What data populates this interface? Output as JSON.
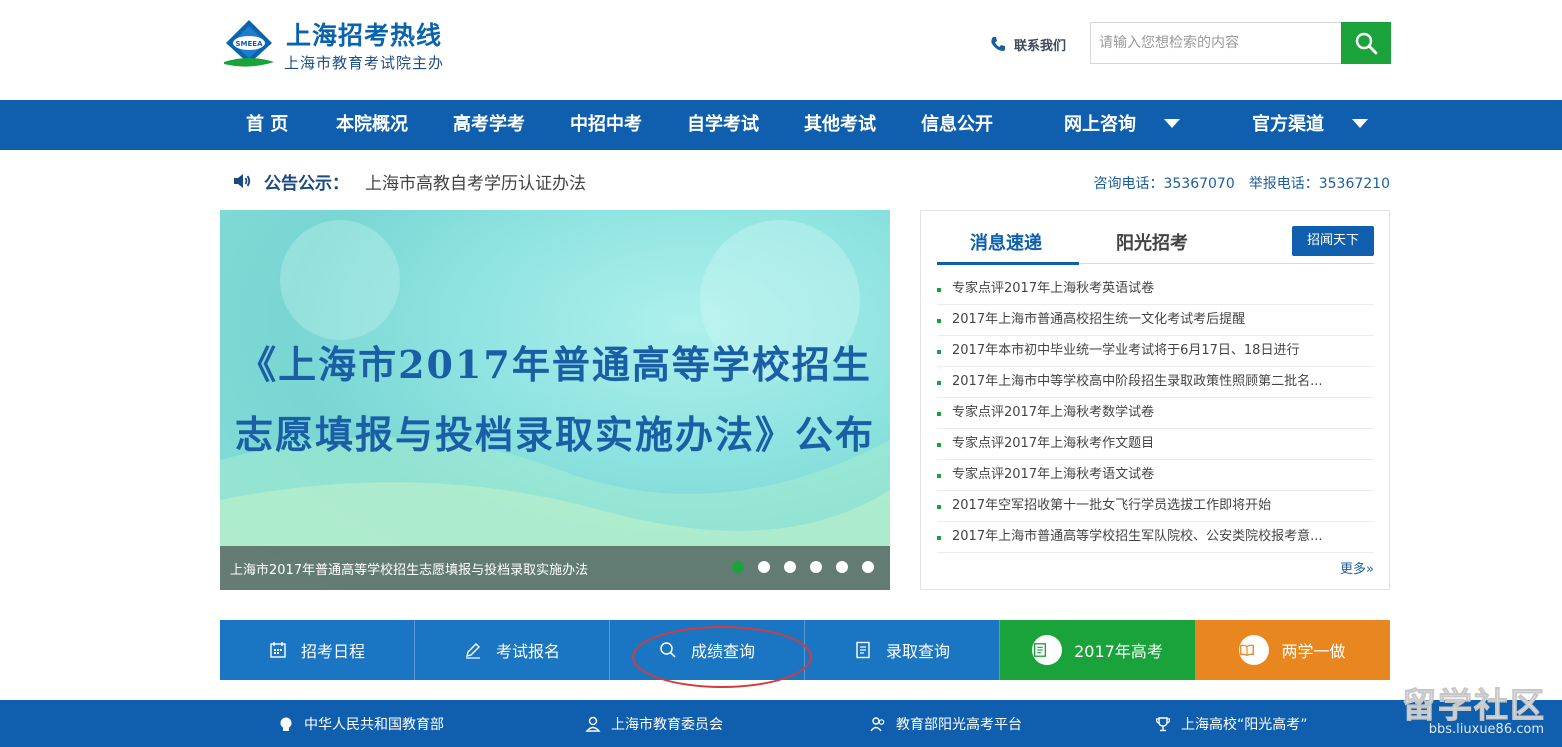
{
  "header": {
    "logo_title": "上海招考热线",
    "logo_subtitle": "上海市教育考试院主办",
    "logo_badge": "SMEEA",
    "contact_label": "联系我们",
    "search_placeholder": "请输入您想检索的内容"
  },
  "nav": {
    "items": [
      "首 页",
      "本院概况",
      "高考学考",
      "中招中考",
      "自学考试",
      "其他考试",
      "信息公开",
      "网上咨询",
      "官方渠道"
    ]
  },
  "notice": {
    "label": "公告公示：",
    "text": "上海市高教自考学历认证办法",
    "consult_phone": "咨询电话：35367070",
    "report_phone": "举报电话：35367210"
  },
  "banner": {
    "headline_line1": "《上海市2017年普通高等学校招生",
    "headline_line2": "志愿填报与投档录取实施办法》公布",
    "caption": "上海市2017年普通高等学校招生志愿填报与投档录取实施办法",
    "slide_count": 6,
    "active_slide": 1
  },
  "news": {
    "tab_active": "消息速递",
    "tab_inactive": "阳光招考",
    "tag_button": "招闻天下",
    "items": [
      "专家点评2017年上海秋考英语试卷",
      "2017年上海市普通高校招生统一文化考试考后提醒",
      "2017年本市初中毕业统一学业考试将于6月17日、18日进行",
      "2017年上海市中等学校高中阶段招生录取政策性照顾第二批名...",
      "专家点评2017年上海秋考数学试卷",
      "专家点评2017年上海秋考作文题目",
      "专家点评2017年上海秋考语文试卷",
      "2017年空军招收第十一批女飞行学员选拔工作即将开始",
      "2017年上海市普通高等学校招生军队院校、公安类院校报考意..."
    ],
    "more": "更多»"
  },
  "quick_links": {
    "schedule": "招考日程",
    "register": "考试报名",
    "score_query": "成绩查询",
    "admission_query": "录取查询",
    "gaokao_2017": "2017年高考",
    "two_study": "两学一做"
  },
  "footer": {
    "links": [
      "中华人民共和国教育部",
      "上海市教育委员会",
      "教育部阳光高考平台",
      "上海高校“阳光高考”"
    ]
  },
  "watermark": {
    "brand": "留学社区",
    "url": "bbs.liuxue86.com"
  },
  "colors": {
    "primary_blue": "#0f5fae",
    "quick_blue": "#1a76c2",
    "green": "#1aa33a",
    "orange": "#e8861f",
    "annotation_red": "#d63a3a"
  }
}
